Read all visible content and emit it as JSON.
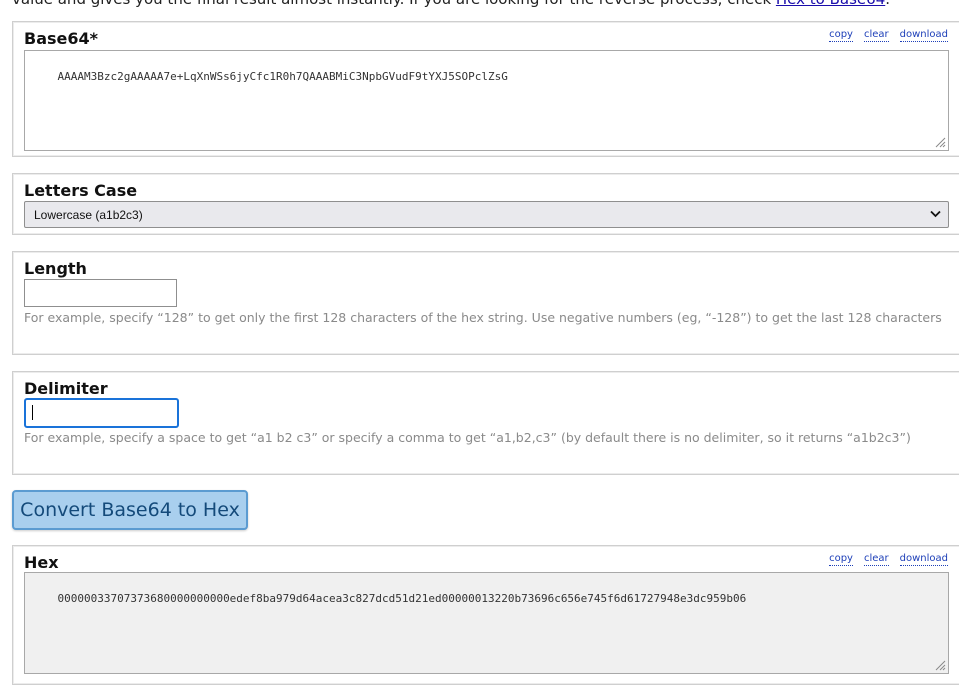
{
  "intro": {
    "text": "value and gives you the final result almost instantly. If you are looking for the reverse process, check ",
    "link": "Hex to Base64",
    "tail": "."
  },
  "base64_panel": {
    "label": "Base64*",
    "tools": {
      "copy": "copy",
      "clear": "clear",
      "download": "download"
    },
    "value": "AAAAM3Bzc2gAAAAA7e+LqXnWSs6jyCfc1R0h7QAAABMiC3NpbGVudF9tYXJ5SOPclZsG"
  },
  "letters_case": {
    "label": "Letters Case",
    "selected": "Lowercase (a1b2c3)"
  },
  "length": {
    "label": "Length",
    "value": "",
    "hint": "For example, specify “128” to get only the first 128 characters of the hex string. Use negative numbers (eg, “-128”) to get the last 128 characters"
  },
  "delimiter": {
    "label": "Delimiter",
    "value": "",
    "hint": "For example, specify a space to get “a1 b2 c3” or specify a comma to get “a1,b2,c3” (by default there is no delimiter, so it returns “a1b2c3”)"
  },
  "convert_button": {
    "label": "Convert Base64 to Hex"
  },
  "hex_panel": {
    "label": "Hex",
    "tools": {
      "copy": "copy",
      "clear": "clear",
      "download": "download"
    },
    "value": "00000033707373680000000000edef8ba979d64acea3c827dcd51d21ed00000013220b73696c656e745f6d61727948e3dc959b06"
  }
}
